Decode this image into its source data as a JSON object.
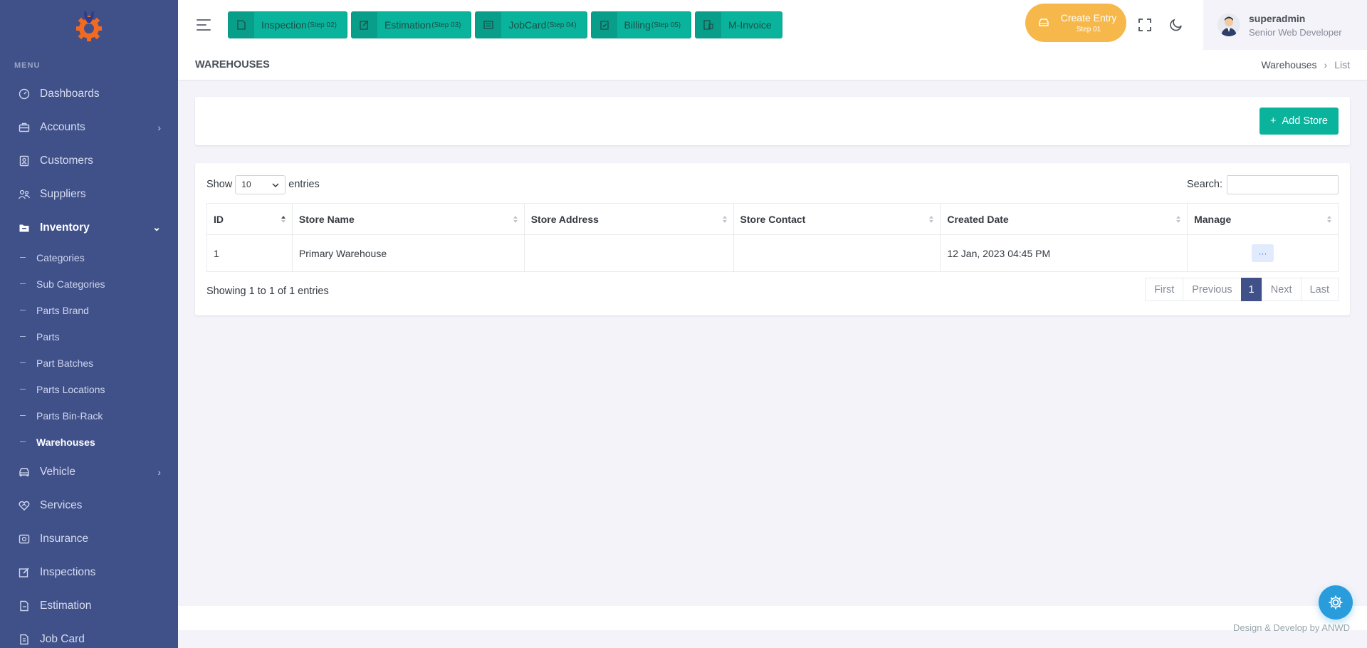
{
  "sidebar": {
    "menu_title": "MENU",
    "items": [
      {
        "label": "Dashboards",
        "icon": "dashboard-icon"
      },
      {
        "label": "Accounts",
        "icon": "briefcase-icon",
        "has_children": true
      },
      {
        "label": "Customers",
        "icon": "contact-icon"
      },
      {
        "label": "Suppliers",
        "icon": "users-icon"
      },
      {
        "label": "Inventory",
        "icon": "folder-icon",
        "expanded": true,
        "active": true
      },
      {
        "label": "Vehicle",
        "icon": "car-icon",
        "has_children": true
      },
      {
        "label": "Services",
        "icon": "heart-handshake-icon"
      },
      {
        "label": "Insurance",
        "icon": "shield-icon"
      },
      {
        "label": "Inspections",
        "icon": "edit-box-icon"
      },
      {
        "label": "Estimation",
        "icon": "file-icon"
      },
      {
        "label": "Job Card",
        "icon": "clipboard-icon"
      }
    ],
    "inventory_sub": [
      "Categories",
      "Sub Categories",
      "Parts Brand",
      "Parts",
      "Part Batches",
      "Parts Locations",
      "Parts Bin-Rack",
      "Warehouses"
    ],
    "active_sub": "Warehouses"
  },
  "topbar": {
    "steps": [
      {
        "label": "Inspection",
        "step": "(Step 02)",
        "icon": "file-doc-icon"
      },
      {
        "label": "Estimation",
        "step": "(Step 03)",
        "icon": "edit-icon"
      },
      {
        "label": "JobCard",
        "step": "(Step 04)",
        "icon": "list-doc-icon"
      },
      {
        "label": "Billing",
        "step": "(Step 05)",
        "icon": "clipboard-check-icon"
      },
      {
        "label": "M-Invoice",
        "step": "",
        "icon": "invoice-icon"
      }
    ],
    "create_entry": {
      "label": "Create Entry",
      "sub": "Step 01"
    },
    "user": {
      "name": "superadmin",
      "role": "Senior Web Developer"
    }
  },
  "page": {
    "title": "WAREHOUSES",
    "breadcrumb": [
      "Warehouses",
      "List"
    ],
    "add_button": "Add Store"
  },
  "table": {
    "show_label": "Show",
    "length_value": "10",
    "entries_label": "entries",
    "search_label": "Search:",
    "search_value": "",
    "columns": [
      "ID",
      "Store Name",
      "Store Address",
      "Store Contact",
      "Created Date",
      "Manage"
    ],
    "rows": [
      {
        "id": "1",
        "name": "Primary Warehouse",
        "address": "",
        "contact": "",
        "created": "12 Jan, 2023 04:45 PM",
        "manage": "···"
      }
    ],
    "info": "Showing 1 to 1 of 1 entries",
    "pager": [
      "First",
      "Previous",
      "1",
      "Next",
      "Last"
    ],
    "current_page": "1"
  },
  "footer": {
    "text": "Design & Develop by ANWD"
  },
  "colors": {
    "sidebar": "#405189",
    "accent": "#0ab39c",
    "warning": "#f7b84b",
    "info": "#299cdb"
  }
}
